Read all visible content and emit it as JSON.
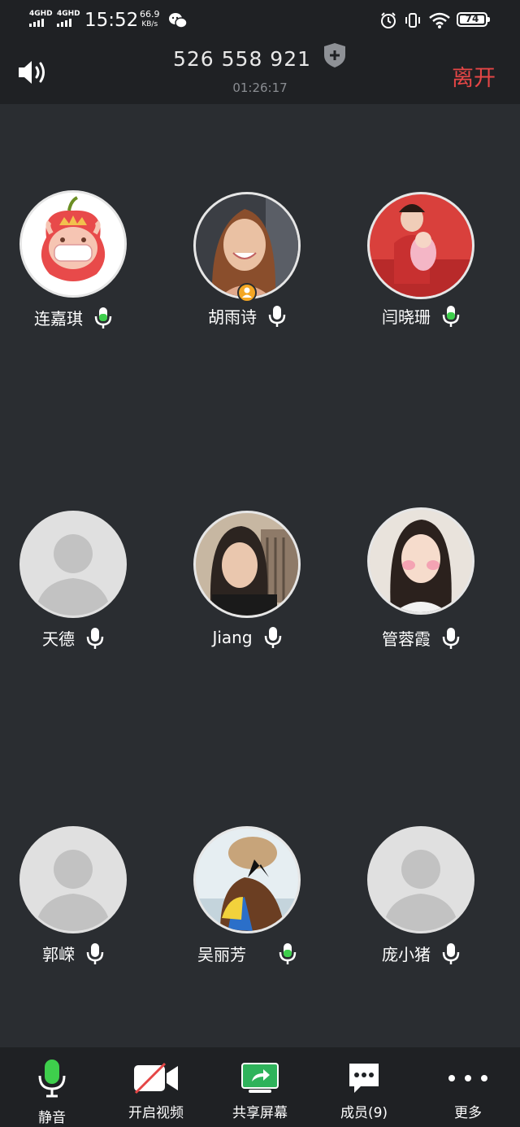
{
  "status_bar": {
    "network1": "4GHD",
    "network2": "4GHD",
    "time": "15:52",
    "speed_value": "66.9",
    "speed_unit": "KB/s",
    "battery": "74"
  },
  "header": {
    "meeting_id": "526 558 921",
    "timer": "01:26:17",
    "leave_label": "离开"
  },
  "participants": [
    {
      "name": "连嘉琪",
      "mic": "active",
      "avatar": "cartoon-pig"
    },
    {
      "name": "胡雨诗",
      "mic": "idle",
      "avatar": "photo",
      "host": true
    },
    {
      "name": "闫晓珊",
      "mic": "active",
      "avatar": "photo"
    },
    {
      "name": "天德",
      "mic": "idle",
      "avatar": "default"
    },
    {
      "name": "Jiang",
      "mic": "idle",
      "avatar": "photo"
    },
    {
      "name": "管蓉霞",
      "mic": "idle",
      "avatar": "photo"
    },
    {
      "name": "郭嵘",
      "mic": "idle",
      "avatar": "default"
    },
    {
      "name": "吴丽芳",
      "mic": "active",
      "avatar": "photo"
    },
    {
      "name": "庞小猪",
      "mic": "idle",
      "avatar": "default"
    }
  ],
  "toolbar": {
    "mute_label": "静音",
    "video_label": "开启视频",
    "share_label": "共享屏幕",
    "members_label": "成员(9)",
    "more_label": "更多"
  },
  "colors": {
    "background": "#2a2d31",
    "bar": "#1f2124",
    "leave": "#e54646",
    "mic_active": "#3ecf4c",
    "share": "#2fb35b"
  }
}
